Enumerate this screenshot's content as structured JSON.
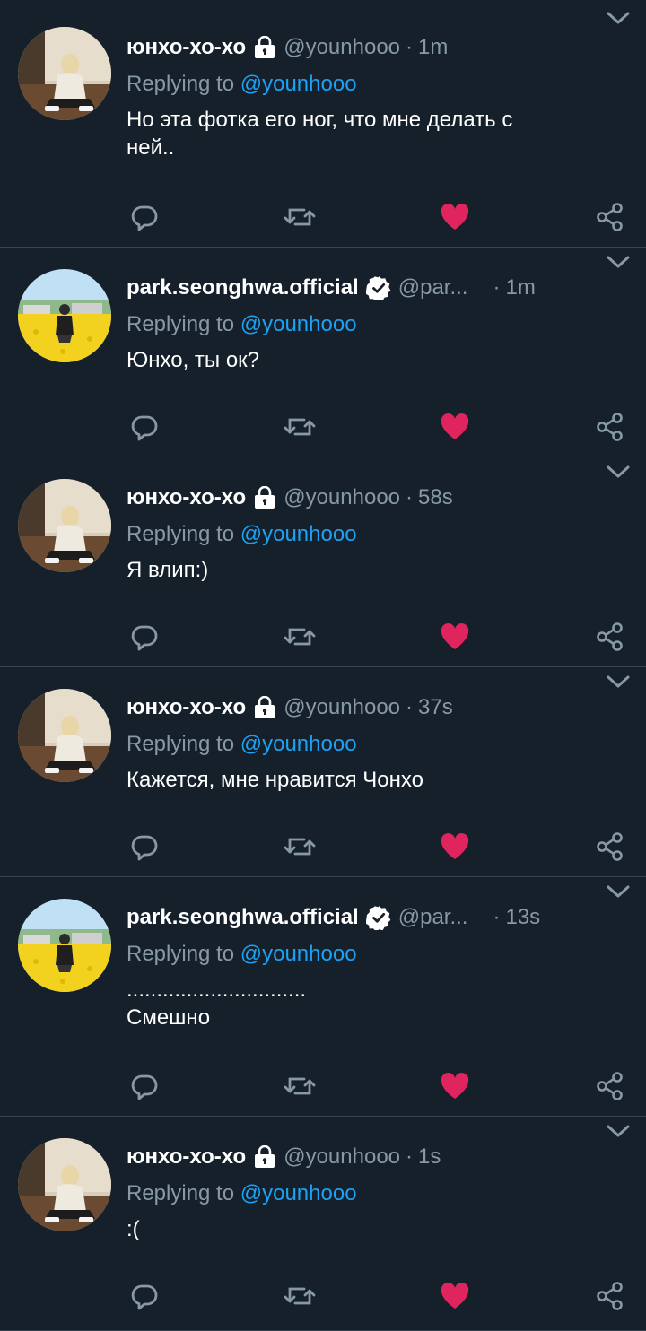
{
  "colors": {
    "background": "#15202b",
    "muted": "#8899a6",
    "accent": "#1da1f2",
    "like": "#e0245e",
    "divider": "#38444d"
  },
  "tweets": [
    {
      "name": "юнхо-хо-хо",
      "badge": "lock-icon",
      "handle": "@younhooo",
      "sep": "·",
      "time": "1m",
      "reply_prefix": "Replying to",
      "reply_mention": "@younhooo",
      "text": "Но эта фотка его ног, что мне делать с\nней..",
      "liked": true
    },
    {
      "name": "park.seonghwa.official",
      "badge": "verified-icon",
      "handle": "@par...",
      "sep": "·",
      "time": "1m",
      "reply_prefix": "Replying to",
      "reply_mention": "@younhooo",
      "text": "Юнхо, ты ок?",
      "liked": true
    },
    {
      "name": "юнхо-хо-хо",
      "badge": "lock-icon",
      "handle": "@younhooo",
      "sep": "·",
      "time": "58s",
      "reply_prefix": "Replying to",
      "reply_mention": "@younhooo",
      "text": "Я влип:)",
      "liked": true
    },
    {
      "name": "юнхо-хо-хо",
      "badge": "lock-icon",
      "handle": "@younhooo",
      "sep": "·",
      "time": "37s",
      "reply_prefix": "Replying to",
      "reply_mention": "@younhooo",
      "text": "Кажется, мне нравится Чонхо",
      "liked": true
    },
    {
      "name": "park.seonghwa.official",
      "badge": "verified-icon",
      "handle": "@par...",
      "sep": "·",
      "time": "13s",
      "reply_prefix": "Replying to",
      "reply_mention": "@younhooo",
      "text": "..............................\nСмешно",
      "liked": true
    },
    {
      "name": "юнхо-хо-хо",
      "badge": "lock-icon",
      "handle": "@younhooo",
      "sep": "·",
      "time": "1s",
      "reply_prefix": "Replying to",
      "reply_mention": "@younhooo",
      "text": ":(",
      "liked": true
    }
  ]
}
